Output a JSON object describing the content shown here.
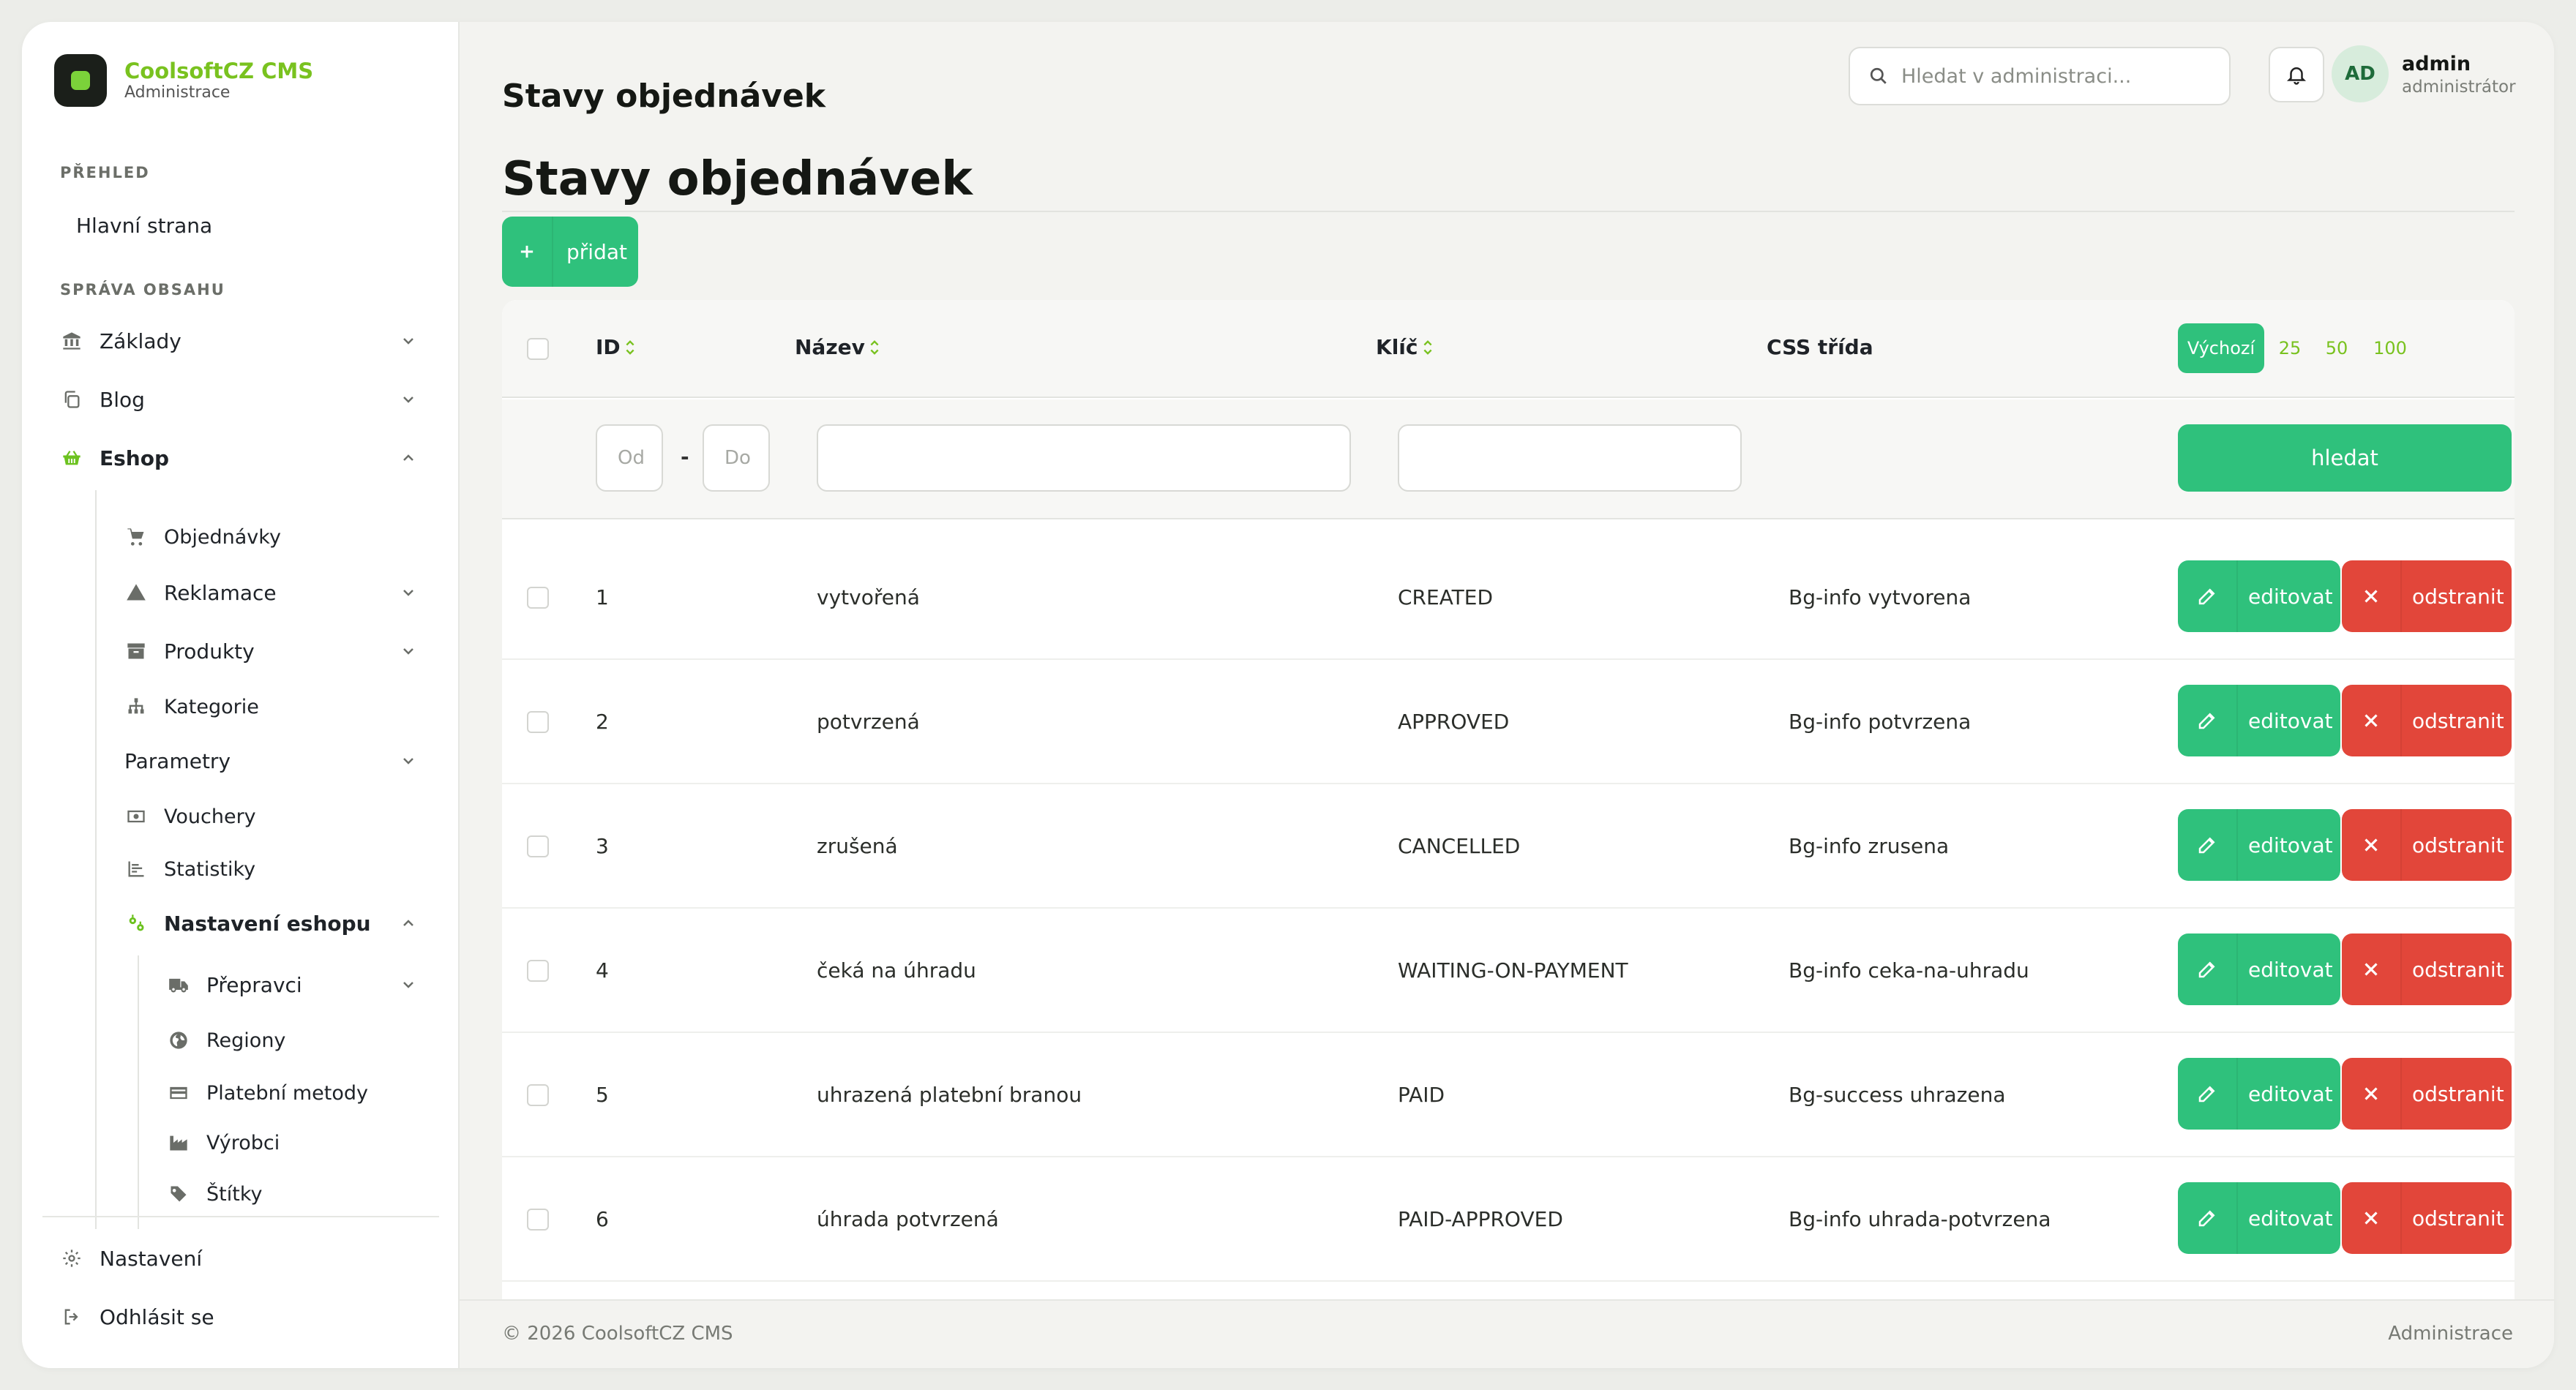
{
  "brand": {
    "name": "CoolsoftCZ CMS",
    "subtitle": "Administrace"
  },
  "sidebar": {
    "section_overview": "PŘEHLED",
    "home": "Hlavní strana",
    "section_content": "SPRÁVA OBSAHU",
    "items": {
      "zaklady": "Základy",
      "blog": "Blog",
      "eshop": "Eshop",
      "objednavky": "Objednávky",
      "reklamace": "Reklamace",
      "produkty": "Produkty",
      "kategorie": "Kategorie",
      "parametry": "Parametry",
      "vouchery": "Vouchery",
      "statistiky": "Statistiky",
      "nastaveni_eshopu": "Nastavení eshopu",
      "prepravci": "Přepravci",
      "regiony": "Regiony",
      "platebni_metody": "Platební metody",
      "vyrobci": "Výrobci",
      "stitky": "Štítky"
    },
    "settings": "Nastavení",
    "logout": "Odhlásit se"
  },
  "header": {
    "title": "Stavy objednávek",
    "search_placeholder": "Hledat v administraci...",
    "user": {
      "initials": "AD",
      "name": "admin",
      "role": "administrátor"
    }
  },
  "page": {
    "title": "Stavy objednávek",
    "add_label": "přidat"
  },
  "table": {
    "columns": {
      "id": "ID",
      "name": "Název",
      "key": "Klíč",
      "css": "CSS třída"
    },
    "per_page": {
      "active": "Výchozí",
      "options": [
        "25",
        "50",
        "100"
      ]
    },
    "filters": {
      "id_from_placeholder": "Od",
      "id_to_placeholder": "Do",
      "search_label": "hledat"
    },
    "edit_label": "editovat",
    "delete_label": "odstranit",
    "rows": [
      {
        "id": "1",
        "name": "vytvořená",
        "key": "CREATED",
        "css": "Bg-info vytvorena"
      },
      {
        "id": "2",
        "name": "potvrzená",
        "key": "APPROVED",
        "css": "Bg-info potvrzena"
      },
      {
        "id": "3",
        "name": "zrušená",
        "key": "CANCELLED",
        "css": "Bg-info zrusena"
      },
      {
        "id": "4",
        "name": "čeká na úhradu",
        "key": "WAITING-ON-PAYMENT",
        "css": "Bg-info ceka-na-uhradu"
      },
      {
        "id": "5",
        "name": "uhrazená platební branou",
        "key": "PAID",
        "css": "Bg-success uhrazena"
      },
      {
        "id": "6",
        "name": "úhrada potvrzená",
        "key": "PAID-APPROVED",
        "css": "Bg-info uhrada-potvrzena"
      }
    ]
  },
  "footer": {
    "copyright": "© 2026 CoolsoftCZ CMS",
    "right": "Administrace"
  },
  "colors": {
    "accent": "#2fc17c",
    "brand_green": "#79c21f",
    "danger": "#e2463a"
  }
}
